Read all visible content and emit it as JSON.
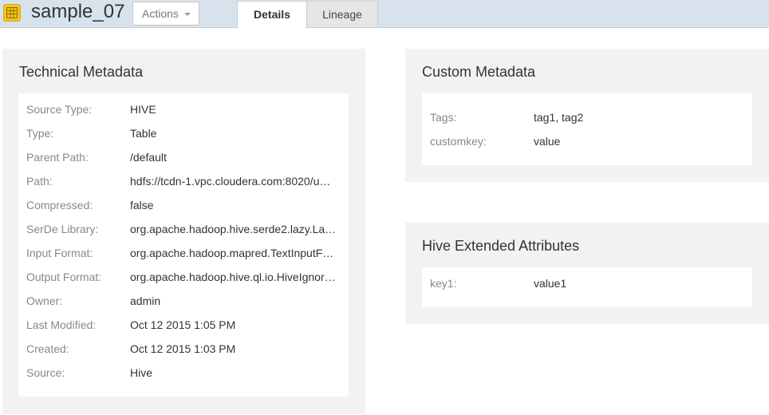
{
  "entity": {
    "icon": "table-icon",
    "name": "sample_07"
  },
  "actions": {
    "label": "Actions"
  },
  "tabs": [
    {
      "label": "Details",
      "active": true
    },
    {
      "label": "Lineage",
      "active": false
    }
  ],
  "technical": {
    "title": "Technical Metadata",
    "rows": [
      {
        "key": "Source Type:",
        "value": "HIVE"
      },
      {
        "key": "Type:",
        "value": "Table"
      },
      {
        "key": "Parent Path:",
        "value": "/default"
      },
      {
        "key": "Path:",
        "value": "hdfs://tcdn-1.vpc.cloudera.com:8020/u…"
      },
      {
        "key": "Compressed:",
        "value": "false"
      },
      {
        "key": "SerDe Library:",
        "value": "org.apache.hadoop.hive.serde2.lazy.La…"
      },
      {
        "key": "Input Format:",
        "value": "org.apache.hadoop.mapred.TextInputF…"
      },
      {
        "key": "Output Format:",
        "value": "org.apache.hadoop.hive.ql.io.HiveIgnor…"
      },
      {
        "key": "Owner:",
        "value": "admin"
      },
      {
        "key": "Last Modified:",
        "value": "Oct 12 2015 1:05 PM"
      },
      {
        "key": "Created:",
        "value": "Oct 12 2015 1:03 PM"
      },
      {
        "key": "Source:",
        "value": "Hive"
      }
    ]
  },
  "custom": {
    "title": "Custom Metadata",
    "rows": [
      {
        "key": "Tags:",
        "value": "tag1, tag2"
      },
      {
        "key": "customkey:",
        "value": "value"
      }
    ]
  },
  "hive_extended": {
    "title": "Hive Extended Attributes",
    "rows": [
      {
        "key": "key1:",
        "value": "value1"
      }
    ]
  },
  "colors": {
    "topbar": "#d8e2ec",
    "panel": "#f2f2f2",
    "icon": "#f5c518"
  }
}
